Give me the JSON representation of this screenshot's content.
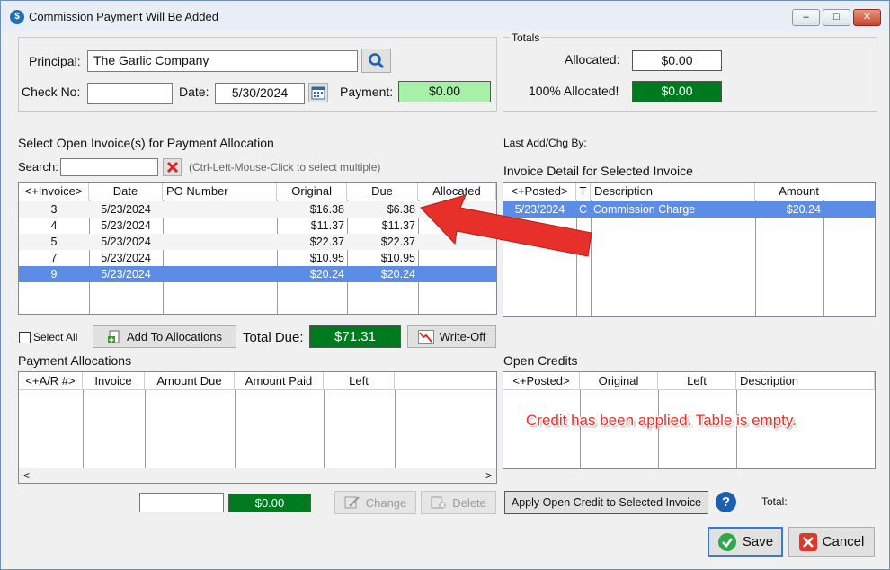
{
  "window": {
    "title": "Commission Payment Will Be Added",
    "min": "–",
    "max": "□",
    "close": "✕"
  },
  "header": {
    "principal_label": "Principal:",
    "principal_value": "The Garlic Company",
    "checkno_label": "Check No:",
    "checkno_value": "",
    "date_label": "Date:",
    "date_value": "5/30/2024",
    "payment_label": "Payment:",
    "payment_value": "$0.00"
  },
  "totals": {
    "group_label": "Totals",
    "allocated_label": "Allocated:",
    "allocated_value": "$0.00",
    "allocated100_label": "100% Allocated!",
    "allocated100_value": "$0.00"
  },
  "invoices": {
    "section_title": "Select Open Invoice(s) for Payment Allocation",
    "search_label": "Search:",
    "search_value": "",
    "search_hint": "(Ctrl-Left-Mouse-Click to select multiple)",
    "columns": [
      "<+Invoice>",
      "Date",
      "PO Number",
      "Original",
      "Due",
      "Allocated"
    ],
    "rows": [
      {
        "invoice": "3",
        "date": "5/23/2024",
        "po": "",
        "original": "$16.38",
        "due": "$6.38",
        "allocated": ""
      },
      {
        "invoice": "4",
        "date": "5/23/2024",
        "po": "",
        "original": "$11.37",
        "due": "$11.37",
        "allocated": ""
      },
      {
        "invoice": "5",
        "date": "5/23/2024",
        "po": "",
        "original": "$22.37",
        "due": "$22.37",
        "allocated": ""
      },
      {
        "invoice": "7",
        "date": "5/23/2024",
        "po": "",
        "original": "$10.95",
        "due": "$10.95",
        "allocated": ""
      },
      {
        "invoice": "9",
        "date": "5/23/2024",
        "po": "",
        "original": "$20.24",
        "due": "$20.24",
        "allocated": ""
      }
    ],
    "selected_row": 4,
    "select_all_label": "Select All",
    "add_button": "Add To Allocations",
    "total_due_label": "Total Due:",
    "total_due_value": "$71.31",
    "writeoff_button": "Write-Off"
  },
  "detail": {
    "last_add_label": "Last Add/Chg By:",
    "section_title": "Invoice Detail for Selected Invoice",
    "columns": [
      "<+Posted>",
      "T",
      "Description",
      "Amount"
    ],
    "rows": [
      {
        "posted": "5/23/2024",
        "t": "C",
        "description": "Commission Charge",
        "amount": "$20.24"
      }
    ]
  },
  "allocations": {
    "section_title": "Payment Allocations",
    "columns": [
      "<+A/R #>",
      "Invoice",
      "Amount Due",
      "Amount Paid",
      "Left"
    ],
    "scroll_left": "<",
    "scroll_right": ">",
    "amount_value": "",
    "green_value": "$0.00",
    "change_button": "Change",
    "delete_button": "Delete"
  },
  "credits": {
    "section_title": "Open Credits",
    "columns": [
      "<+Posted>",
      "Original",
      "Left",
      "Description"
    ],
    "annotation": "Credit has been applied.  Table is empty.",
    "apply_button": "Apply Open Credit to Selected Invoice",
    "help": "?",
    "total_label": "Total:"
  },
  "footer": {
    "save_button": "Save",
    "cancel_button": "Cancel"
  },
  "colors": {
    "green": "#007a1e",
    "light_green": "#a8f0a8",
    "selection": "#5b8ce6",
    "annotation": "#e8302a"
  }
}
